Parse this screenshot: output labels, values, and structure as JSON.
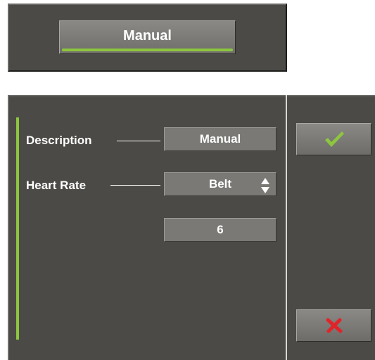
{
  "header": {
    "mode_label": "Manual"
  },
  "form": {
    "description": {
      "label": "Description",
      "value": "Manual"
    },
    "heart_rate": {
      "label": "Heart Rate",
      "value": "Belt"
    },
    "numeric_field": {
      "value": "6"
    }
  },
  "actions": {
    "confirm_icon": "check-icon",
    "cancel_icon": "close-icon"
  },
  "colors": {
    "panel": "#4b4a46",
    "accent": "#8dc63f",
    "cancel": "#e0242a",
    "field": "#7a7975"
  }
}
